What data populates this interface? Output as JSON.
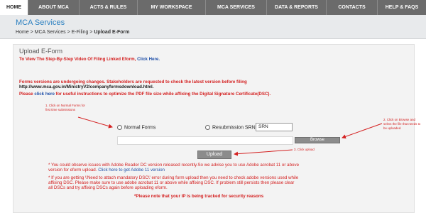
{
  "nav": {
    "items": [
      "HOME",
      "ABOUT MCA",
      "ACTS & RULES",
      "MY WORKSPACE",
      "MCA SERVICES",
      "DATA & REPORTS",
      "CONTACTS",
      "HELP & FAQS"
    ],
    "active": "HOME"
  },
  "section": {
    "title": "MCA Services",
    "breadcrumb": {
      "home": "Home",
      "sep": " > ",
      "services": "MCA Services",
      "efiling": "E-Filing",
      "current": "Upload E-Form"
    }
  },
  "main": {
    "title": "Upload E-Form",
    "video_line": "To View The Step-By-Step Video Of Filing Linked Eform,",
    "video_link": "Click Here.",
    "versions_notice": "Forms versions are undergoing changes. Stakeholders are requested to check the latest version before filing",
    "versions_url": "http://www.mca.gov.in/MinistryV2/companyformsdownload.html.",
    "please_prefix": "Please",
    "click_here": "click here",
    "please_suffix": "for useful instructions to optimize the PDF file size while affixing the Digital Signature Certificate(DSC).",
    "radio_normal": "Normal Forms",
    "radio_resubmission": "Resubmission SRN",
    "srn_value": "SRN",
    "browse_label": "Browse",
    "upload_label": "Upload",
    "note1_line1": "* You could observe issues with Adobe Reader DC version released recently.So we advise you to use Adobe acrobat 11 or above",
    "note1_line2": "version for eform upload.",
    "note1_link": "Click here to get Adobe 11 version",
    "note2_line1": "* If you are getting \\'Need to attach mandatory DSC\\' error during form upload then you need to check adobe versions used while",
    "note2_line2": "affixing DSC. Please make sure to use adobe acrobat 11 or above while affixing DSC. If problem still persists then please clear",
    "note2_line3": "all DSCs and try affixing DSCs again before uploading eform.",
    "ip_notice": "*Please note that your IP is being tracked for security reasons"
  },
  "annotations": {
    "a1": "1. Click on Normal Forms for first time submissions",
    "a2": "2. Click on Browse and select the file that needs to be uploaded.",
    "a3": "3. Click upload"
  },
  "colors": {
    "nav_bg": "#6b6b6b",
    "accent_blue": "#2a7fc0",
    "alert_red": "#d42020",
    "button_gray": "#8c8c8c"
  }
}
